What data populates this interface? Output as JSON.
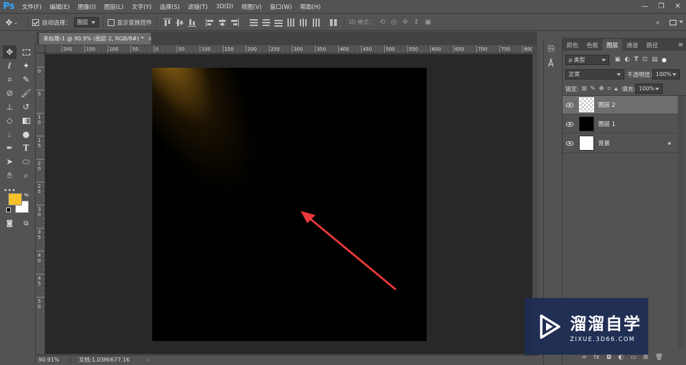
{
  "app": {
    "logo": "Ps"
  },
  "menubar": {
    "items": [
      "文件(F)",
      "编辑(E)",
      "图像(I)",
      "图层(L)",
      "文字(Y)",
      "选择(S)",
      "滤镜(T)",
      "3D(D)",
      "视图(V)",
      "窗口(W)",
      "帮助(H)"
    ],
    "window_controls": [
      "minimize-icon",
      "restore-icon",
      "close-icon"
    ]
  },
  "options_bar": {
    "auto_select_label": "自动选择：",
    "auto_select_checked": true,
    "target_value": "图层",
    "show_transform_label": "显示变换控件",
    "show_transform_checked": false,
    "mode_3d_label": "3D 模式："
  },
  "document": {
    "tab_title": "未标题-1 @ 90.9% (图层 2, RGB/8#) *",
    "ruler_h_labels": [
      "200",
      "150",
      "100",
      "50",
      "0",
      "50",
      "100",
      "150",
      "200",
      "250",
      "300",
      "350",
      "400",
      "450",
      "500",
      "550",
      "600",
      "650",
      "700",
      "750",
      "800"
    ],
    "ruler_v_labels": [
      "0",
      "5",
      "1 0",
      "1 5",
      "2 0",
      "2 5",
      "3 0",
      "3 5",
      "4 0",
      "4 5",
      "5 0"
    ],
    "canvas_bg": "#000000",
    "light_color": "#f0b82b"
  },
  "status_bar": {
    "zoom": "90.91%",
    "doc_info": "文档:1.03M/677.1K",
    "arrow": "›"
  },
  "colors": {
    "foreground": "#f5c227",
    "background": "#ffffff",
    "arrow_red": "#e8383b",
    "accent_blue": "#31a8ff"
  },
  "layers_panel": {
    "tabs": [
      "颜色",
      "色板",
      "图层",
      "通道",
      "路径"
    ],
    "active_tab": "图层",
    "filter_label": "ρ 类型",
    "blend_mode": "正常",
    "opacity_label": "不透明度:",
    "opacity_value": "100%",
    "lock_label": "锁定:",
    "fill_label": "填充:",
    "fill_value": "100%",
    "layers": [
      {
        "name": "图层 2",
        "thumb": "transparent",
        "selected": true,
        "locked": false
      },
      {
        "name": "图层 1",
        "thumb": "black",
        "selected": false,
        "locked": false
      },
      {
        "name": "背景",
        "thumb": "white",
        "selected": false,
        "locked": true
      }
    ]
  },
  "watermark": {
    "title": "溜溜自学",
    "url": "ZIXUE.3D66.COM"
  }
}
